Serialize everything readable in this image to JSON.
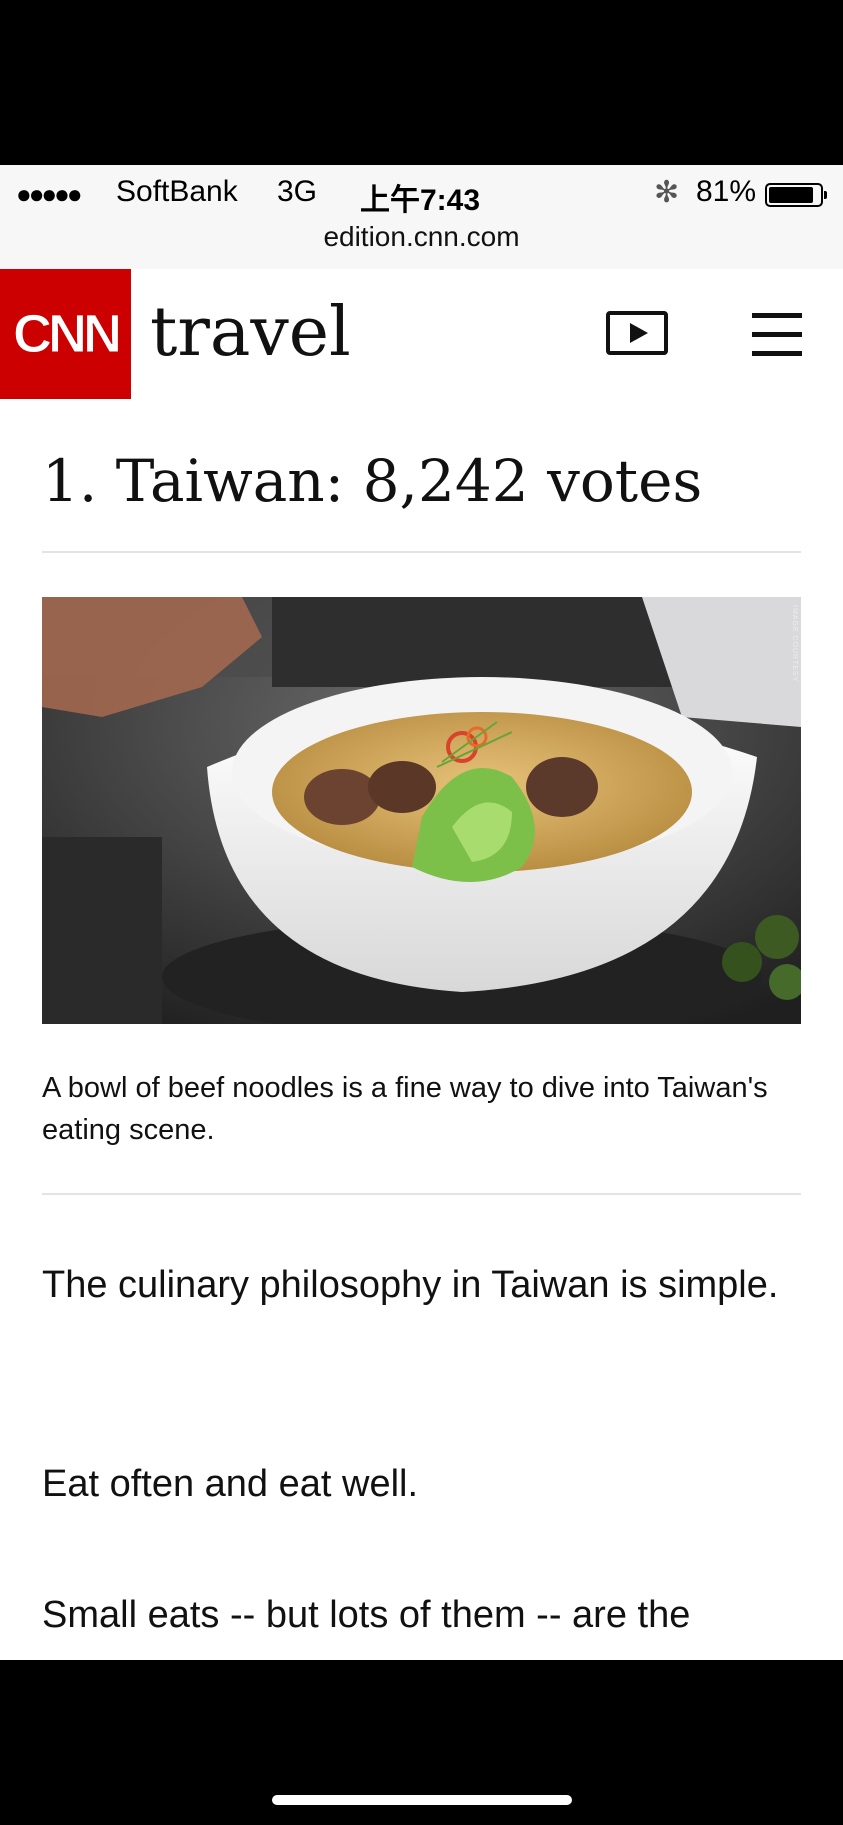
{
  "status_bar": {
    "signal": "●●●●●",
    "carrier": "SoftBank",
    "network": "3G",
    "time": "上午7:43",
    "bluetooth": "✻",
    "battery_percent": "81%"
  },
  "browser": {
    "url": "edition.cnn.com"
  },
  "header": {
    "logo_text": "CNN",
    "section": "travel"
  },
  "article": {
    "headline": "1. Taiwan: 8,242 votes",
    "photo_alt": "Bowl of beef noodle soup",
    "photo_credit": "IMAGE COURTESY",
    "caption": "A bowl of beef noodles is a fine way to dive into Taiwan's eating scene.",
    "paragraphs": [
      "The culinary philosophy in Taiwan is simple.",
      "Eat often and eat well.",
      "Small eats -- but lots of them -- are the"
    ]
  }
}
